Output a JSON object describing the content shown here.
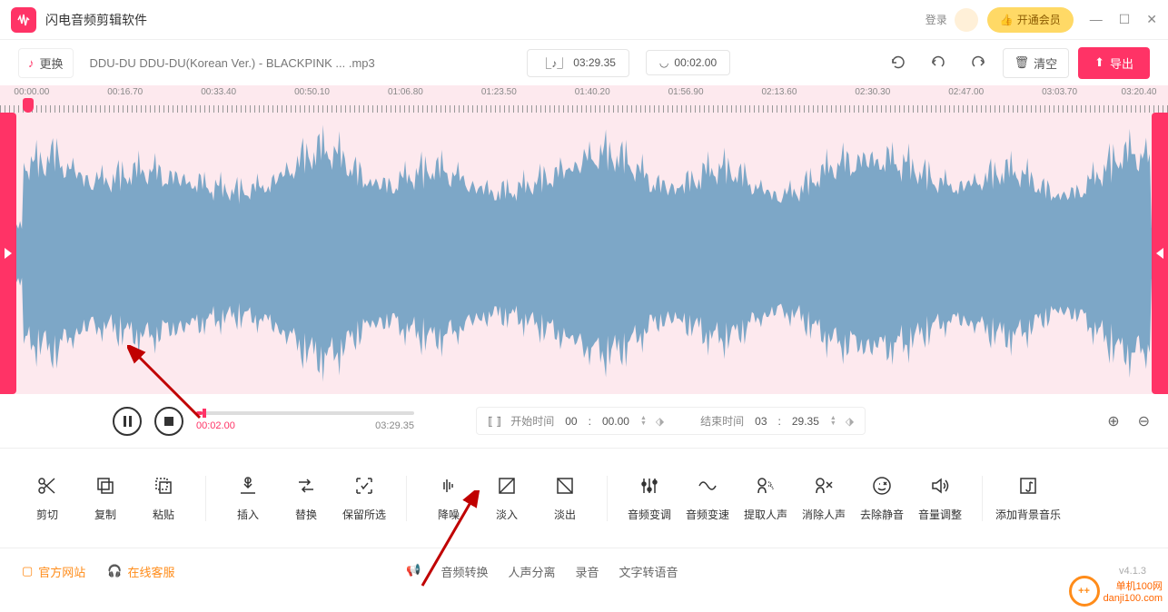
{
  "app": {
    "title": "闪电音频剪辑软件"
  },
  "titlebar": {
    "login": "登录",
    "vip": "开通会员"
  },
  "toolbar": {
    "switch": "更换",
    "filename": "DDU-DU DDU-DU(Korean Ver.) - BLACKPINK ... .mp3",
    "total_time": "03:29.35",
    "cursor_time": "00:02.00",
    "clear": "清空",
    "export": "导出"
  },
  "ruler": [
    "00:00.00",
    "00:16.70",
    "00:33.40",
    "00:50.10",
    "01:06.80",
    "01:23.50",
    "01:40.20",
    "01:56.90",
    "02:13.60",
    "02:30.30",
    "02:47.00",
    "03:03.70",
    "03:20.40"
  ],
  "playback": {
    "current": "00:02.00",
    "total": "03:29.35",
    "start_label": "开始时间",
    "start_m": "00",
    "start_s": "00.00",
    "end_label": "结束时间",
    "end_m": "03",
    "end_s": "29.35"
  },
  "tools": {
    "cut": "剪切",
    "copy": "复制",
    "paste": "粘贴",
    "insert": "插入",
    "replace": "替换",
    "keep": "保留所选",
    "denoise": "降噪",
    "fadein": "淡入",
    "fadeout": "淡出",
    "pitch": "音频变调",
    "speed": "音频变速",
    "extract": "提取人声",
    "remove_vocal": "消除人声",
    "remove_silence": "去除静音",
    "volume": "音量调整",
    "bgm": "添加背景音乐"
  },
  "footer": {
    "website": "官方网站",
    "support": "在线客服",
    "convert": "音频转换",
    "vocal_sep": "人声分离",
    "record": "录音",
    "tts": "文字转语音",
    "version": "v4.1.3"
  },
  "watermark": {
    "line1": "单机100网",
    "line2": "danji100.com"
  }
}
